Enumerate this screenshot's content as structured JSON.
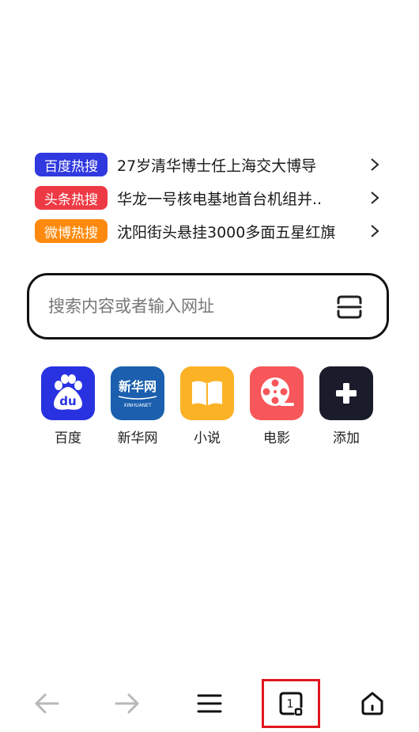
{
  "hot_search": [
    {
      "badge": "百度热搜",
      "badge_color": "#3038e0",
      "text": "27岁清华博士任上海交大博导"
    },
    {
      "badge": "头条热搜",
      "badge_color": "#ee3a45",
      "text": "华龙一号核电基地首台机组并.."
    },
    {
      "badge": "微博热搜",
      "badge_color": "#fd8a0e",
      "text": "沈阳街头悬挂3000多面五星红旗"
    }
  ],
  "search": {
    "placeholder": "搜索内容或者输入网址",
    "scan_icon": "scan-icon"
  },
  "quick_links": [
    {
      "label": "百度",
      "icon": "baidu-paw-icon",
      "color": "#2932e1",
      "icon_text": "du"
    },
    {
      "label": "新华网",
      "icon": "xinhua-logo-icon",
      "color": "#1b5fae",
      "icon_text": "新华网",
      "icon_subtext": "XINHUANET"
    },
    {
      "label": "小说",
      "icon": "book-icon",
      "color": "#fbb225"
    },
    {
      "label": "电影",
      "icon": "film-reel-icon",
      "color": "#f7575a"
    },
    {
      "label": "添加",
      "icon": "plus-icon",
      "color": "#1b1c2b"
    }
  ],
  "bottom_bar": {
    "tab_count": "1",
    "icons": [
      "back-arrow-icon",
      "forward-arrow-icon",
      "menu-icon",
      "tabs-icon",
      "home-icon"
    ]
  }
}
